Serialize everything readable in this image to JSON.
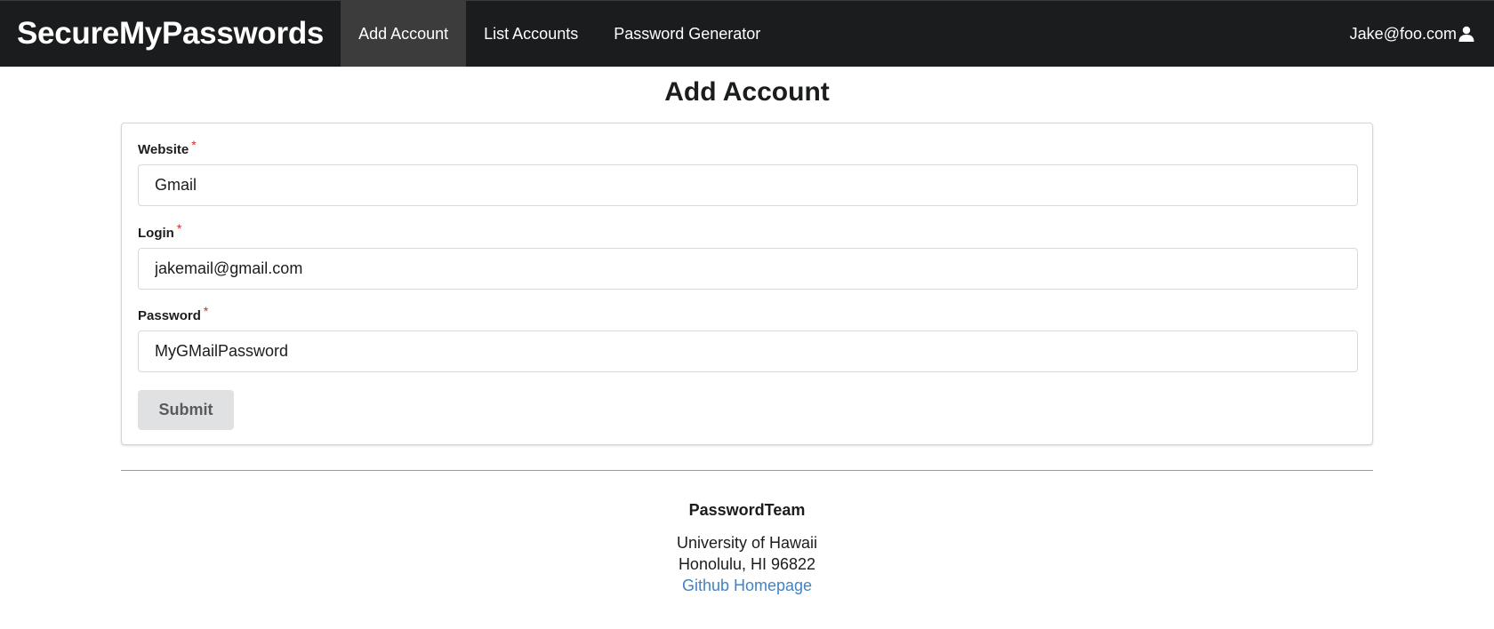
{
  "navbar": {
    "brand": "SecureMyPasswords",
    "items": [
      {
        "label": "Add Account",
        "active": true
      },
      {
        "label": "List Accounts",
        "active": false
      },
      {
        "label": "Password Generator",
        "active": false
      }
    ],
    "user_email": "Jake@foo.com",
    "user_icon": "user-icon"
  },
  "page": {
    "title": "Add Account"
  },
  "form": {
    "required_marker": "*",
    "fields": [
      {
        "label": "Website",
        "value": "Gmail"
      },
      {
        "label": "Login",
        "value": "jakemail@gmail.com"
      },
      {
        "label": "Password",
        "value": "MyGMailPassword"
      }
    ],
    "submit_label": "Submit"
  },
  "footer": {
    "team": "PasswordTeam",
    "address_line1": "University of Hawaii",
    "address_line2": "Honolulu, HI 96822",
    "link_label": "Github Homepage"
  },
  "colors": {
    "navbar_bg": "#1b1c1d",
    "active_nav_bg": "#3c3c3c",
    "required": "#db2828",
    "link": "#4183c4",
    "button_bg": "#e0e1e2"
  }
}
